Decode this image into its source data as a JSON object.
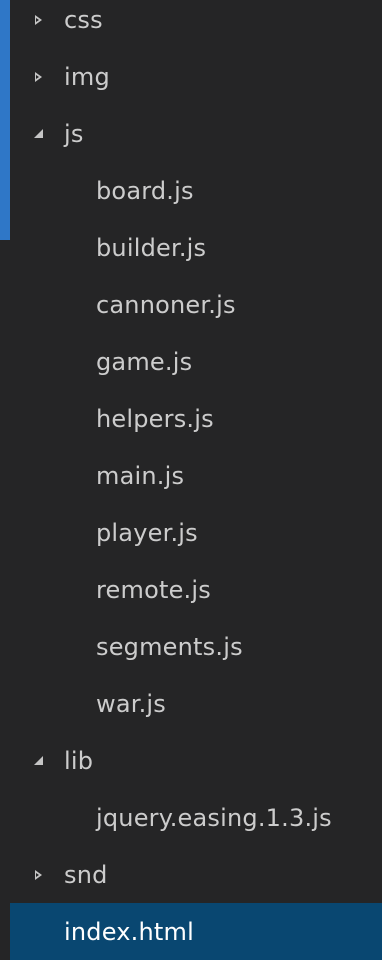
{
  "explorer": {
    "items": [
      {
        "name": "css",
        "type": "folder",
        "state": "collapsed",
        "indent": 0
      },
      {
        "name": "img",
        "type": "folder",
        "state": "collapsed",
        "indent": 0
      },
      {
        "name": "js",
        "type": "folder",
        "state": "expanded",
        "indent": 0
      },
      {
        "name": "board.js",
        "type": "file",
        "indent": 1
      },
      {
        "name": "builder.js",
        "type": "file",
        "indent": 1
      },
      {
        "name": "cannoner.js",
        "type": "file",
        "indent": 1
      },
      {
        "name": "game.js",
        "type": "file",
        "indent": 1
      },
      {
        "name": "helpers.js",
        "type": "file",
        "indent": 1
      },
      {
        "name": "main.js",
        "type": "file",
        "indent": 1
      },
      {
        "name": "player.js",
        "type": "file",
        "indent": 1
      },
      {
        "name": "remote.js",
        "type": "file",
        "indent": 1
      },
      {
        "name": "segments.js",
        "type": "file",
        "indent": 1
      },
      {
        "name": "war.js",
        "type": "file",
        "indent": 1
      },
      {
        "name": "lib",
        "type": "folder",
        "state": "expanded",
        "indent": 0
      },
      {
        "name": "jquery.easing.1.3.js",
        "type": "file",
        "indent": 1
      },
      {
        "name": "snd",
        "type": "folder",
        "state": "collapsed",
        "indent": 0
      },
      {
        "name": "index.html",
        "type": "file",
        "indent": 0,
        "selected": true
      }
    ]
  },
  "colors": {
    "background": "#252526",
    "text": "#cccccc",
    "selected_background": "#094771",
    "blue_backdrop": "#2f77c7"
  },
  "icons": {
    "collapsed": "chevron-right-icon",
    "expanded": "chevron-down-icon"
  }
}
